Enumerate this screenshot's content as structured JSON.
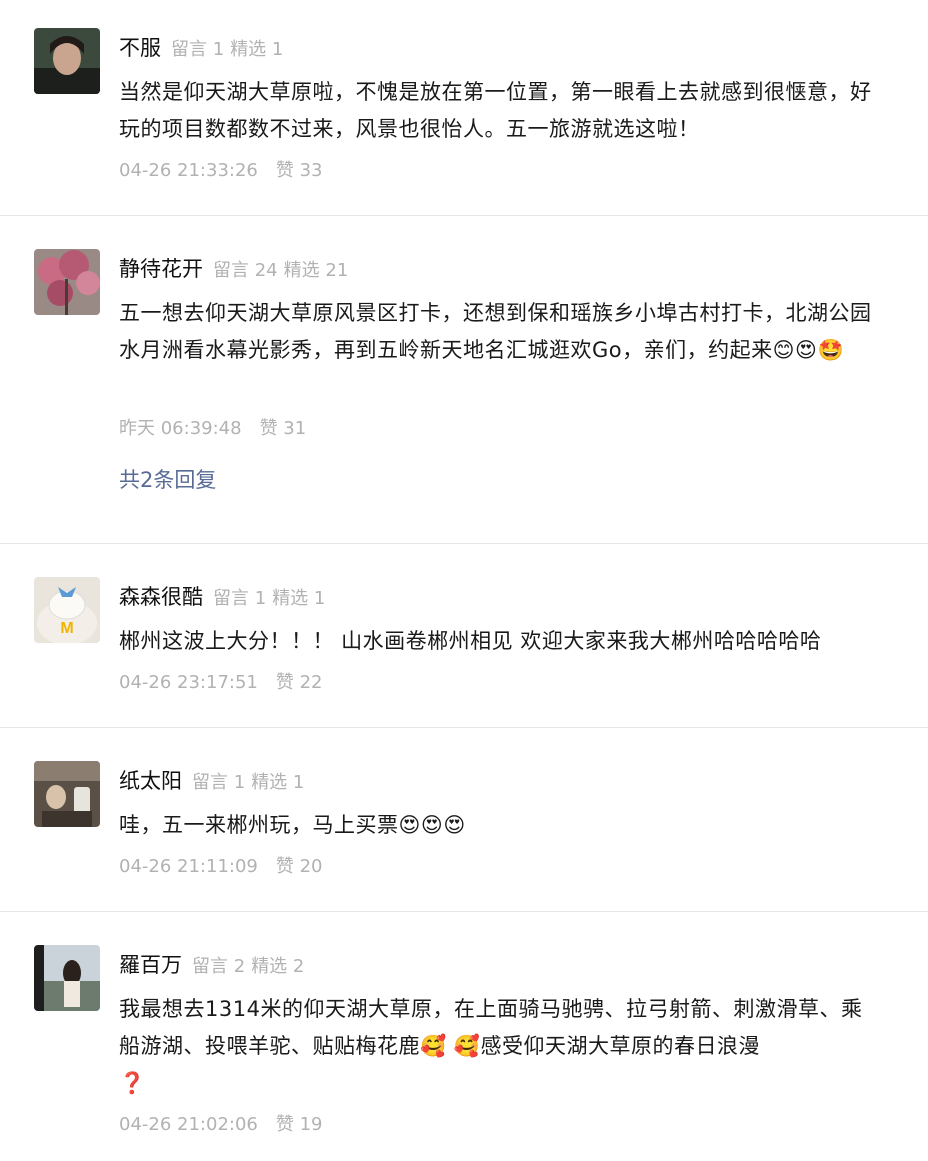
{
  "comments": [
    {
      "nickname": "不服",
      "messages_label": "留言 1",
      "featured_label": "精选 1",
      "content": "当然是仰天湖大草原啦，不愧是放在第一位置，第一眼看上去就感到很惬意，好玩的项目数都数不过来，风景也很怡人。五一旅游就选这啦！",
      "time": "04-26 21:33:26",
      "likes": "赞 33"
    },
    {
      "nickname": "静待花开",
      "messages_label": "留言 24",
      "featured_label": "精选 21",
      "content": "五一想去仰天湖大草原风景区打卡，还想到保和瑶族乡小埠古村打卡，北湖公园水月洲看水幕光影秀，再到五岭新天地名汇城逛欢Go，亲们，约起来",
      "emojis": [
        "😊",
        "😍",
        "🤩"
      ],
      "time": "昨天 06:39:48",
      "likes": "赞 31",
      "reply_link": "共2条回复"
    },
    {
      "nickname": "森森很酷",
      "messages_label": "留言 1",
      "featured_label": "精选 1",
      "content": "郴州这波上大分！！！ 山水画卷郴州相见 欢迎大家来我大郴州哈哈哈哈哈",
      "time": "04-26 23:17:51",
      "likes": "赞 22"
    },
    {
      "nickname": "纸太阳",
      "messages_label": "留言 1",
      "featured_label": "精选 1",
      "content": "哇，五一来郴州玩，马上买票",
      "emojis": [
        "😍",
        "😍",
        "😍"
      ],
      "time": "04-26 21:11:09",
      "likes": "赞 20"
    },
    {
      "nickname": "羅百万",
      "messages_label": "留言 2",
      "featured_label": "精选 2",
      "content_part1": "我最想去1314米的仰天湖大草原，在上面骑马驰骋、拉弓射箭、刺激滑草、乘船游湖、投喂羊驼、贴贴梅花鹿",
      "emojis_mid": [
        "🥰",
        "🥰"
      ],
      "content_part2": "感受仰天湖大草原的春日浪漫",
      "emojis_end": [
        "❓"
      ],
      "time": "04-26 21:02:06",
      "likes": "赞 19"
    }
  ]
}
